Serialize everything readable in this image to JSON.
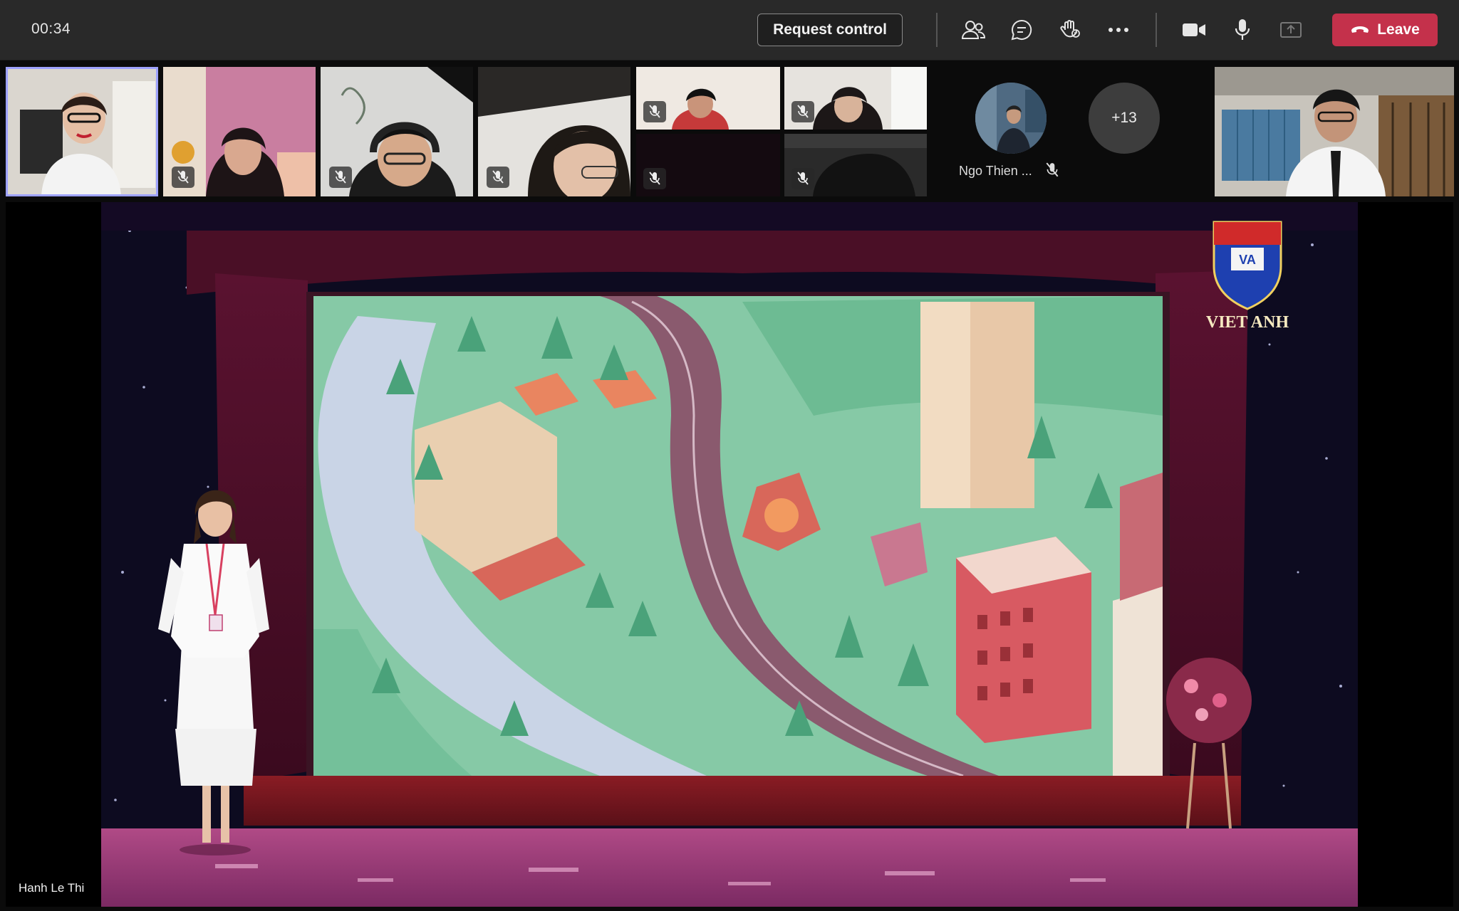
{
  "topbar": {
    "timer": "00:34",
    "request_control_label": "Request control",
    "leave_label": "Leave",
    "icons": [
      "people-icon",
      "chat-icon",
      "raise-hand-icon",
      "more-options-icon",
      "camera-icon",
      "microphone-icon",
      "share-tray-icon",
      "phone-hangup-icon"
    ]
  },
  "participants": {
    "named_tile": "Ngo Thien ...",
    "overflow_count": "+13"
  },
  "stage": {
    "presenter_name": "Hanh Le Thi",
    "logo_text": "VIET ANH",
    "logo_badge": "VA"
  },
  "colors": {
    "leave": "#c4314b",
    "active_outline": "#9ea2ff",
    "topbar": "#292929"
  }
}
